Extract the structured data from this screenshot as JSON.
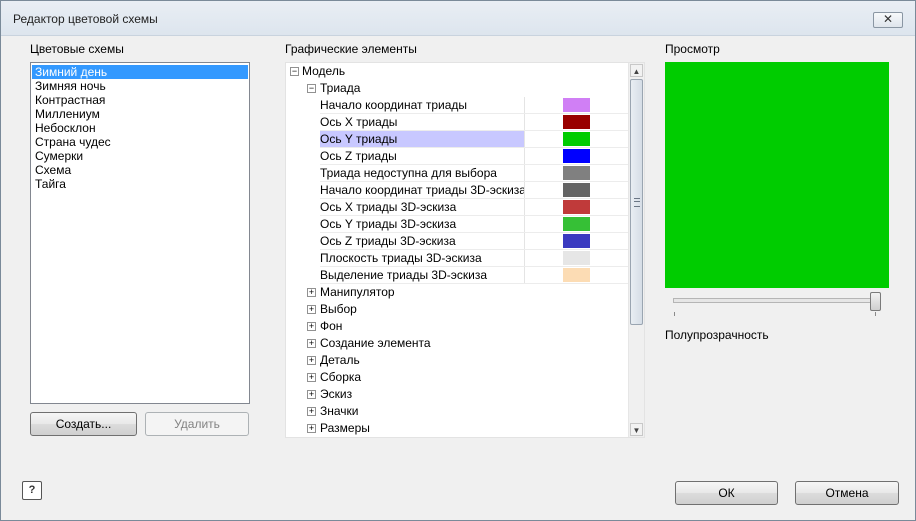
{
  "window": {
    "title": "Редактор цветовой схемы",
    "close_label": "✕"
  },
  "schemes": {
    "label": "Цветовые схемы",
    "items": [
      "Зимний день",
      "Зимняя ночь",
      "Контрастная",
      "Миллениум",
      "Небосклон",
      "Страна чудес",
      "Сумерки",
      "Схема",
      "Тайга"
    ],
    "selected": "Зимний день",
    "create_label": "Создать...",
    "delete_label": "Удалить"
  },
  "elements": {
    "label": "Графические элементы",
    "root_label": "Модель",
    "group_label": "Триада",
    "leaves": [
      {
        "label": "Начало координат триады",
        "color": "#d07ff5"
      },
      {
        "label": "Ось X триады",
        "color": "#990000"
      },
      {
        "label": "Ось Y триады",
        "color": "#00cc00"
      },
      {
        "label": "Ось Z триады",
        "color": "#0000ff"
      },
      {
        "label": "Триада недоступна для выбора",
        "color": "#808080"
      },
      {
        "label": "Начало координат триады 3D-эскиза",
        "color": "#646464"
      },
      {
        "label": "Ось X триады 3D-эскиза",
        "color": "#c03a3a"
      },
      {
        "label": "Ось Y триады 3D-эскиза",
        "color": "#36c036"
      },
      {
        "label": "Ось Z триады 3D-эскиза",
        "color": "#3a3ac0"
      },
      {
        "label": "Плоскость триады 3D-эскиза",
        "color": "#e6e6e6"
      },
      {
        "label": "Выделение триады 3D-эскиза",
        "color": "#fcdcb4"
      }
    ],
    "selected_leaf": "Ось Y триады",
    "collapsed": [
      "Манипулятор",
      "Выбор",
      "Фон",
      "Создание элемента",
      "Деталь",
      "Сборка",
      "Эскиз",
      "Значки",
      "Размеры"
    ]
  },
  "preview": {
    "label": "Просмотр",
    "color": "#00cc00",
    "transparency_label": "Полупрозрачность",
    "transparency_level": 1.0
  },
  "footer": {
    "help_label": "?",
    "ok_label": "ОК",
    "cancel_label": "Отмена"
  }
}
